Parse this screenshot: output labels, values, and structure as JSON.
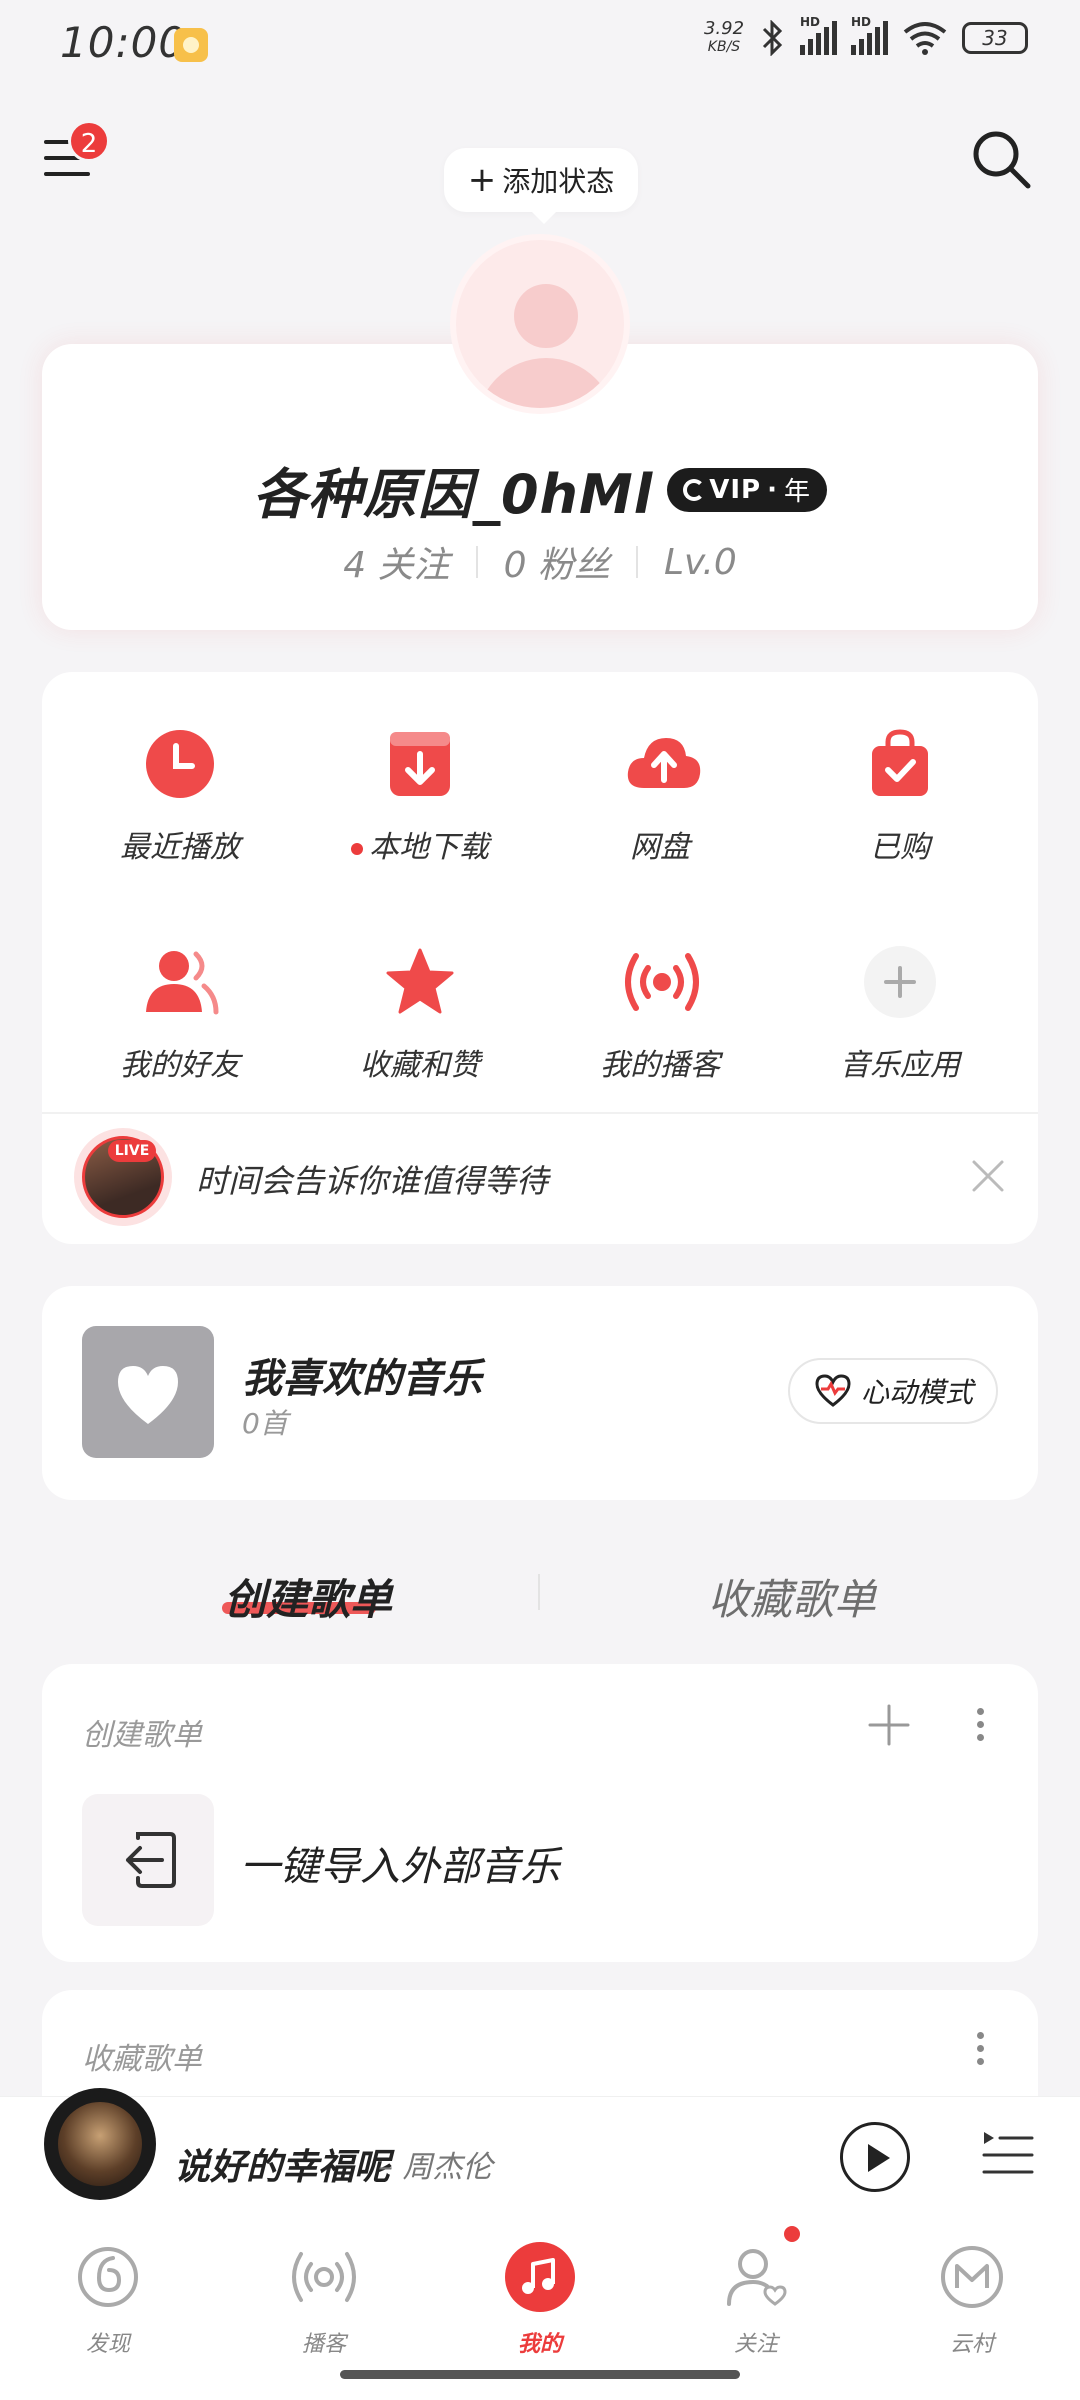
{
  "status_bar": {
    "time": "10:00",
    "net_speed_top": "3.92",
    "net_speed_bottom": "KB/S",
    "battery": "33",
    "hd1": "HD",
    "hd2": "HD"
  },
  "header": {
    "menu_badge": "2",
    "status_button": "添加状态"
  },
  "profile": {
    "username": "各种原因_0hMl",
    "vip_label": "VIP",
    "vip_term": "年",
    "following": "4 关注",
    "followers": "0 粉丝",
    "level": "Lv.0"
  },
  "quick_grid": {
    "items": [
      {
        "label": "最近播放",
        "icon": "clock-icon"
      },
      {
        "label": "本地下载",
        "icon": "download-icon"
      },
      {
        "label": "网盘",
        "icon": "cloud-upload-icon"
      },
      {
        "label": "已购",
        "icon": "shopping-bag-icon"
      },
      {
        "label": "我的好友",
        "icon": "friends-icon"
      },
      {
        "label": "收藏和赞",
        "icon": "star-icon"
      },
      {
        "label": "我的播客",
        "icon": "podcast-icon"
      },
      {
        "label": "音乐应用",
        "icon": "plus-icon"
      }
    ],
    "live": {
      "tag": "LIVE",
      "text": "时间会告诉你谁值得等待"
    }
  },
  "liked": {
    "title": "我喜欢的音乐",
    "count": "0首",
    "mode_button": "心动模式"
  },
  "tabs": {
    "created": "创建歌单",
    "collected": "收藏歌单"
  },
  "created_section": {
    "title": "创建歌单",
    "import_label": "一键导入外部音乐"
  },
  "collected_section": {
    "title": "收藏歌单"
  },
  "player": {
    "song": "说好的幸福呢",
    "artist": "– 周杰伦"
  },
  "nav": {
    "items": [
      "发现",
      "播客",
      "我的",
      "关注",
      "云村"
    ],
    "active": "我的"
  },
  "colors": {
    "accent": "#ec3c3c",
    "background": "#f5f4f6"
  }
}
